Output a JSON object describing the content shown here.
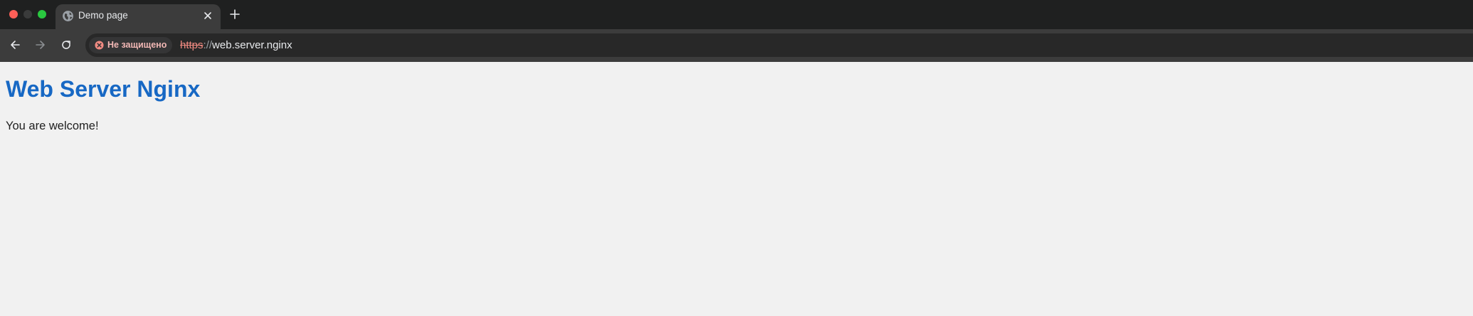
{
  "browser": {
    "tab": {
      "title": "Demo page",
      "favicon": "globe-icon"
    },
    "toolbar": {
      "security_chip": {
        "label": "Не защищено",
        "icon": "error-circle-icon",
        "color": "#f2b8b5"
      },
      "url": {
        "scheme": "https",
        "separator": "://",
        "host": "web.server.nginx"
      }
    },
    "colors": {
      "tab_strip": "#1f2020",
      "toolbar": "#3c3c3c",
      "omnibox": "#282828",
      "close_dot": "#fe5f57",
      "maximize_dot": "#2ac840"
    }
  },
  "page": {
    "heading": "Web Server Nginx",
    "text": "You are welcome!",
    "heading_color": "#1768c4",
    "background": "#f1f1f1"
  }
}
